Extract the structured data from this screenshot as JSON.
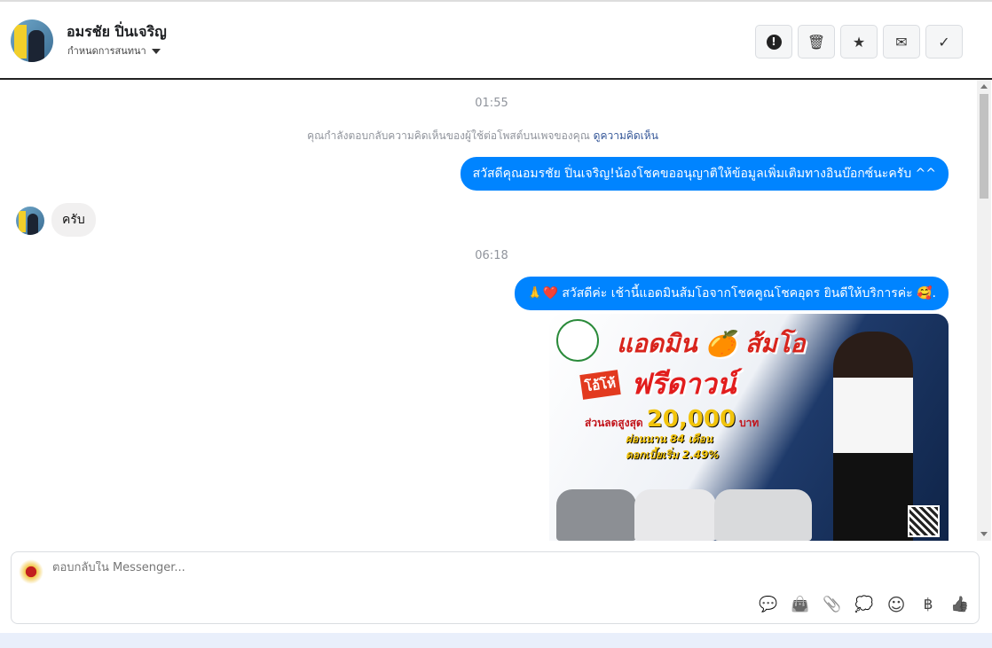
{
  "header": {
    "name": "อมรชัย ปิ่นเจริญ",
    "subtitle": "กำหนดการสนทนา",
    "actions": [
      {
        "icon": "alert-icon",
        "glyph": "!"
      },
      {
        "icon": "trash-icon",
        "glyph": "🗑"
      },
      {
        "icon": "star-icon",
        "glyph": "★"
      },
      {
        "icon": "mail-icon",
        "glyph": "✉"
      },
      {
        "icon": "check-icon",
        "glyph": "✓"
      }
    ]
  },
  "chat": {
    "time1": "01:55",
    "notice": "คุณกำลังตอบกลับความคิดเห็นของผู้ใช้ต่อโพสต์บนเพจของคุณ",
    "notice_link": "ดูความคิดเห็น",
    "msg1": "สวัสดีคุณอมรชัย ปิ่นเจริญ!น้องโชคขออนุญาติให้ข้อมูลเพิ่มเติมทางอินบ๊อกซ์นะครับ ^^",
    "reply": "ครับ",
    "time2": "06:18",
    "msg2": "🙏❤️ สวัสดีค่ะ เช้านี้แอดมินส้มโอจากโชคคูณโชคอุดร ยินดีให้บริการค่ะ 🥰.",
    "ad": {
      "title": "แอดมิน 🍊 ส้มโอ",
      "wow": "โอ้โห้",
      "free_down": "ฟรีดาวน์",
      "discount_label": "ส่วนลดสูงสุด",
      "discount": "20,000",
      "currency": "บาท",
      "installment": "ผ่อนนาน 84 เดือน",
      "interest": "ดอกเบี้ยเริ่ม 2.49%"
    }
  },
  "composer": {
    "placeholder": "ตอบกลับใน Messenger...",
    "tools": [
      {
        "icon": "star-message-icon",
        "glyph": "💬"
      },
      {
        "icon": "shop-bag-icon",
        "glyph": "👜"
      },
      {
        "icon": "paperclip-icon",
        "glyph": "📎"
      },
      {
        "icon": "saved-replies-icon",
        "glyph": "💭"
      },
      {
        "icon": "emoji-icon",
        "glyph": "☺"
      },
      {
        "icon": "baht-icon",
        "glyph": "฿"
      },
      {
        "icon": "like-icon",
        "glyph": "👍"
      }
    ]
  }
}
